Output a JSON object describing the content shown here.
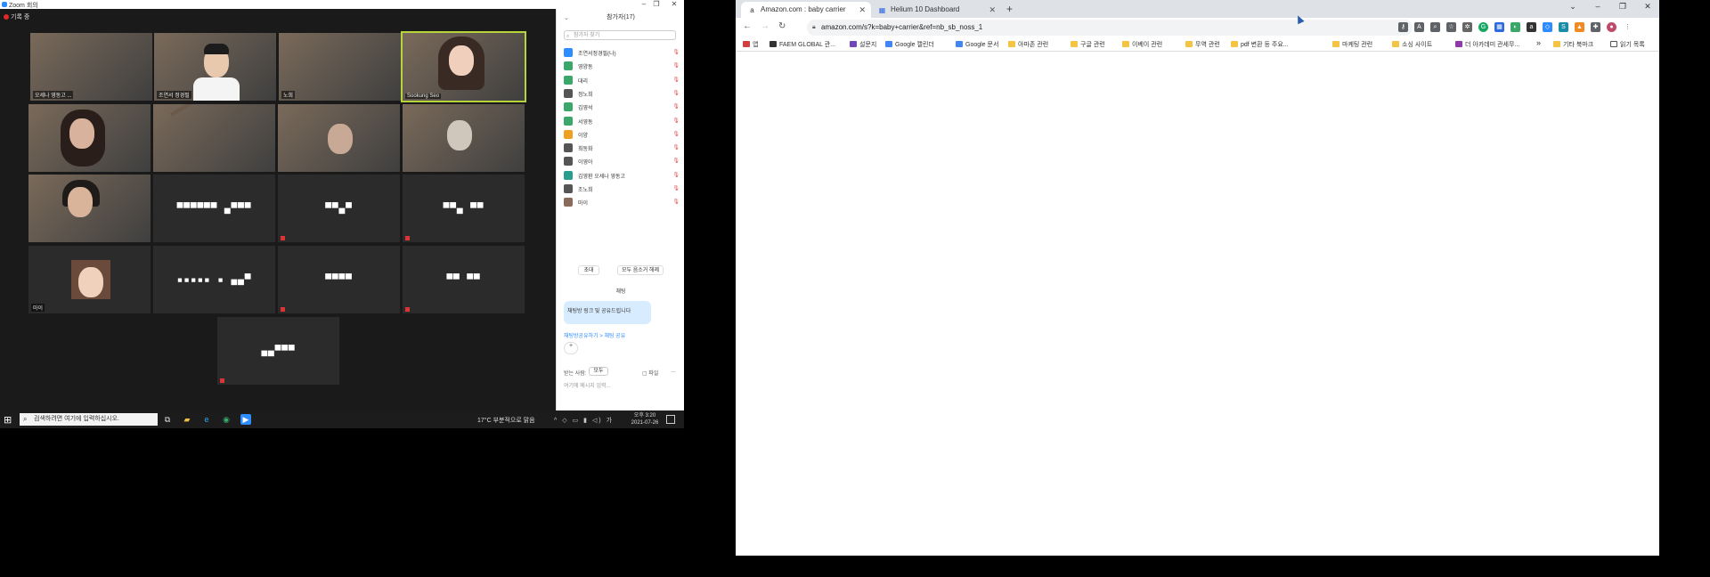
{
  "zoom": {
    "title": "Zoom 회의",
    "recording": "기록 중",
    "tiles": [
      {
        "name": "오세나 영동고 ..."
      },
      {
        "name": "조연서 정경필"
      },
      {
        "name": "노희"
      },
      {
        "name": "Sookung Seo"
      },
      {
        "name": ""
      },
      {
        "name": ""
      },
      {
        "name": ""
      },
      {
        "name": ""
      },
      {
        "name": ""
      },
      {
        "name": "",
        "pix": "▀▀▀▀▀▀ ▄▀▀▀"
      },
      {
        "name": "",
        "pix": "▀▀▄▀"
      },
      {
        "name": "",
        "pix": "▀▀▄ ▀▀"
      },
      {
        "name": "마이"
      },
      {
        "name": "",
        "pix": "▪▪▪▪▪ ▪ ▄▄▀"
      },
      {
        "name": "",
        "pix": "▀▀▀▀"
      },
      {
        "name": "",
        "pix": "▀▀ ▀▀"
      },
      {
        "name": "",
        "pix": "▄▄▀▀▀"
      }
    ],
    "panel": {
      "title": "참가자(17)",
      "search_placeholder": "참가자 찾기",
      "participants": [
        {
          "name": "조연서정경필(나)",
          "color": "#2d8cff"
        },
        {
          "name": "영양동",
          "color": "#3aa86b"
        },
        {
          "name": "대리",
          "color": "#3aa86b"
        },
        {
          "name": "정노희",
          "color": "#555"
        },
        {
          "name": "김영석",
          "color": "#3aa86b"
        },
        {
          "name": "서영동",
          "color": "#3aa86b"
        },
        {
          "name": "이양",
          "color": "#f0a020"
        },
        {
          "name": "최동화",
          "color": "#555"
        },
        {
          "name": "이영아",
          "color": "#555"
        },
        {
          "name": "김영환 오세나 영동고",
          "color": "#2a9e8e"
        },
        {
          "name": "조노희",
          "color": "#555"
        },
        {
          "name": "마이",
          "color": "#8a6a5a"
        }
      ],
      "invite_label": "초대",
      "mute_all_label": "모두 음소거 해제",
      "chat_title": "채팅",
      "chat_message": "채팅방 링크 및 공유드립니다",
      "chat_link": "채팅방공유하기 > 채팅 공유",
      "react": "+",
      "to_label": "받는 사람:",
      "to_value": "모두",
      "file_label": "파일",
      "more": "...",
      "input_placeholder": "여기에 메시지 입력..."
    },
    "taskbar": {
      "search_placeholder": "검색하려면 여기에 입력하십시오.",
      "weather": "17°C 부분적으로 맑음",
      "time": "오후 3:20",
      "date": "2021-07-26",
      "tray": "^ ◇ ▭ ▮ ◁) 가"
    }
  },
  "chrome": {
    "tabs": [
      {
        "title": "Amazon.com : baby carrier",
        "fav": "a",
        "active": true
      },
      {
        "title": "Helium 10 Dashboard",
        "fav": "▦",
        "active": false
      }
    ],
    "url": "amazon.com/s?k=baby+carrier&ref=nb_sb_noss_1",
    "bookmarks": [
      {
        "label": "앱",
        "color": "#d04040"
      },
      {
        "label": "FAEM GLOBAL 관...",
        "color": "#333"
      },
      {
        "label": "설문지",
        "color": "#7248b9"
      },
      {
        "label": "Google 캘린더",
        "color": "#4285f4"
      },
      {
        "label": "Google 문서",
        "color": "#4285f4"
      },
      {
        "label": "아마존 관련",
        "color": "#f4c542"
      },
      {
        "label": "구글 관련",
        "color": "#f4c542"
      },
      {
        "label": "이베이 관련",
        "color": "#f4c542"
      },
      {
        "label": "무역 관련",
        "color": "#f4c542"
      },
      {
        "label": "pdf 변환 등 주요...",
        "color": "#f4c542"
      },
      {
        "label": "마케팅 관련",
        "color": "#f4c542"
      },
      {
        "label": "소싱 사이트",
        "color": "#f4c542"
      },
      {
        "label": "더 아카데미 관세무...",
        "color": "#8e3aa8"
      }
    ],
    "bookmarks_more": "»",
    "other_bookmarks": "기타 북마크",
    "reading_list": "읽기 목록"
  }
}
